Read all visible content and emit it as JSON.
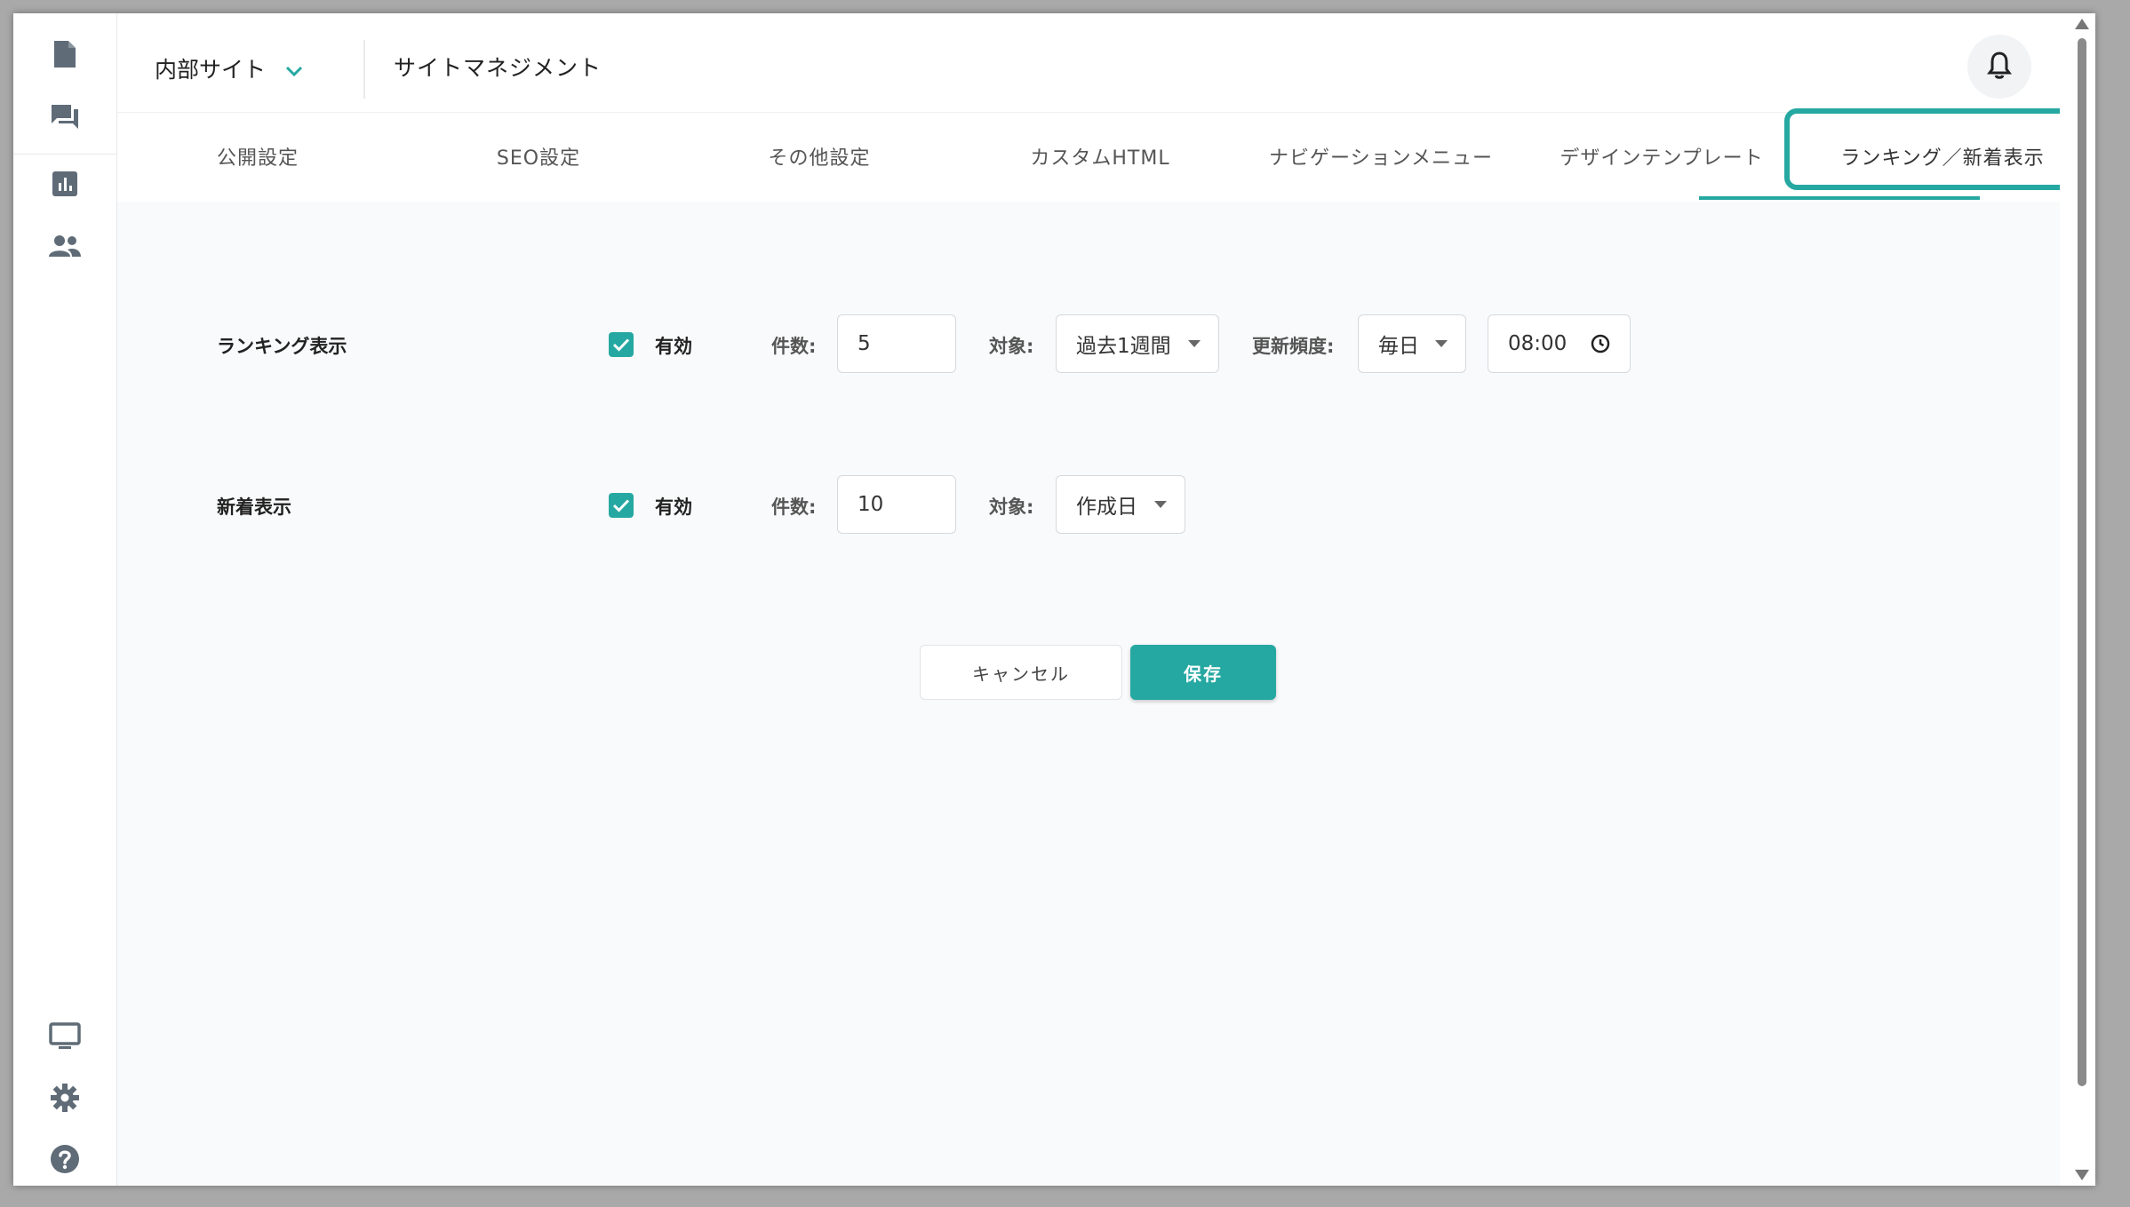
{
  "header": {
    "site_name": "内部サイト",
    "page_title": "サイトマネジメント"
  },
  "tabs": [
    {
      "label": "公開設定"
    },
    {
      "label": "SEO設定"
    },
    {
      "label": "その他設定"
    },
    {
      "label": "カスタムHTML"
    },
    {
      "label": "ナビゲーションメニュー"
    },
    {
      "label": "デザインテンプレート"
    },
    {
      "label": "ランキング／新着表示",
      "active": true
    }
  ],
  "ranking": {
    "label": "ランキング表示",
    "enabled_label": "有効",
    "count_label": "件数:",
    "count_value": "5",
    "target_label": "対象:",
    "target_value": "過去1週間",
    "frequency_label": "更新頻度:",
    "frequency_value": "毎日",
    "time_value": "08:00"
  },
  "newest": {
    "label": "新着表示",
    "enabled_label": "有効",
    "count_label": "件数:",
    "count_value": "10",
    "target_label": "対象:",
    "target_value": "作成日"
  },
  "actions": {
    "cancel_label": "キャンセル",
    "save_label": "保存"
  },
  "colors": {
    "accent": "#26a8a2",
    "icon": "#5f6b77"
  },
  "icons": {
    "rail_top": [
      "document-icon",
      "chat-icon",
      "chart-icon",
      "users-icon"
    ],
    "rail_bottom": [
      "monitor-icon",
      "gear-icon",
      "help-icon"
    ],
    "header": [
      "chevron-down-icon",
      "bell-icon"
    ]
  }
}
